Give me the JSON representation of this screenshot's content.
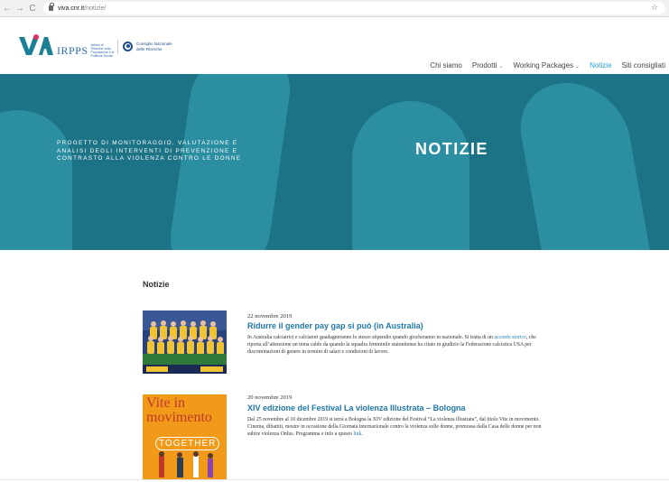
{
  "browser": {
    "back": "←",
    "forward": "→",
    "reload": "C",
    "url_host": "viva.cnr.it",
    "url_path": "/notizie/",
    "bookmark_icon": "star-icon"
  },
  "header": {
    "logo_via": "VIVA",
    "irpps_mark": "IRPPS",
    "irpps_text": "Istituto di Ricerche sulla Popolazione e le Politiche Sociali",
    "cnr_text_1": "Consiglio Nazionale",
    "cnr_text_2": "delle Ricerche",
    "nav": {
      "chi_siamo": "Chi siamo",
      "prodotti": "Prodotti",
      "working_packages": "Working Packages",
      "notizie": "Notizie",
      "siti": "Siti consigliati"
    },
    "chevron": "⌄"
  },
  "hero": {
    "tagline": "Progetto di monitoraggio, valutazione e analisi degli interventi di prevenzione e contrasto alla violenza contro le donne",
    "title": "NOTIZIE",
    "color": "#1c7386"
  },
  "content": {
    "section_title": "Notizie",
    "items": [
      {
        "date": "22 novembre 2019",
        "title": "Ridurre il gender pay gap si può (in Australia)",
        "body_1": "In Australia calciatrici e calciatori guadagneranno lo stesso stipendio quando giocheranno in nazionale. Si tratta di un ",
        "link": "accordo storico",
        "body_2": ", che riporta all’attenzione un tema caldo da quando la squadra femminile statunitense ha citato in giudizio la Federazione calcistica USA per discriminazioni di genere in termini di salari e condizioni di lavoro."
      },
      {
        "date": "20 novembre 2019",
        "title": "XIV edizione del Festival La violenza Illustrata – Bologna",
        "body_1": "Dal 25 novembre al 10 dicembre 2019 si terrà a Bologna la XIV edizione del Festival “La violenza illustrata”, dal titolo Vite in movimento. Cinema, dibattiti, mostre in occasione della Giornata internazionale contro la violenza sulle donne, promossa dalla Casa delle donne per non subire violenza Onlus. Programma e info a questo ",
        "link": "link",
        "body_2": ".",
        "poster_line_1": "Vite in",
        "poster_line_2": "movimento",
        "poster_word": "TOGETHER"
      }
    ]
  }
}
